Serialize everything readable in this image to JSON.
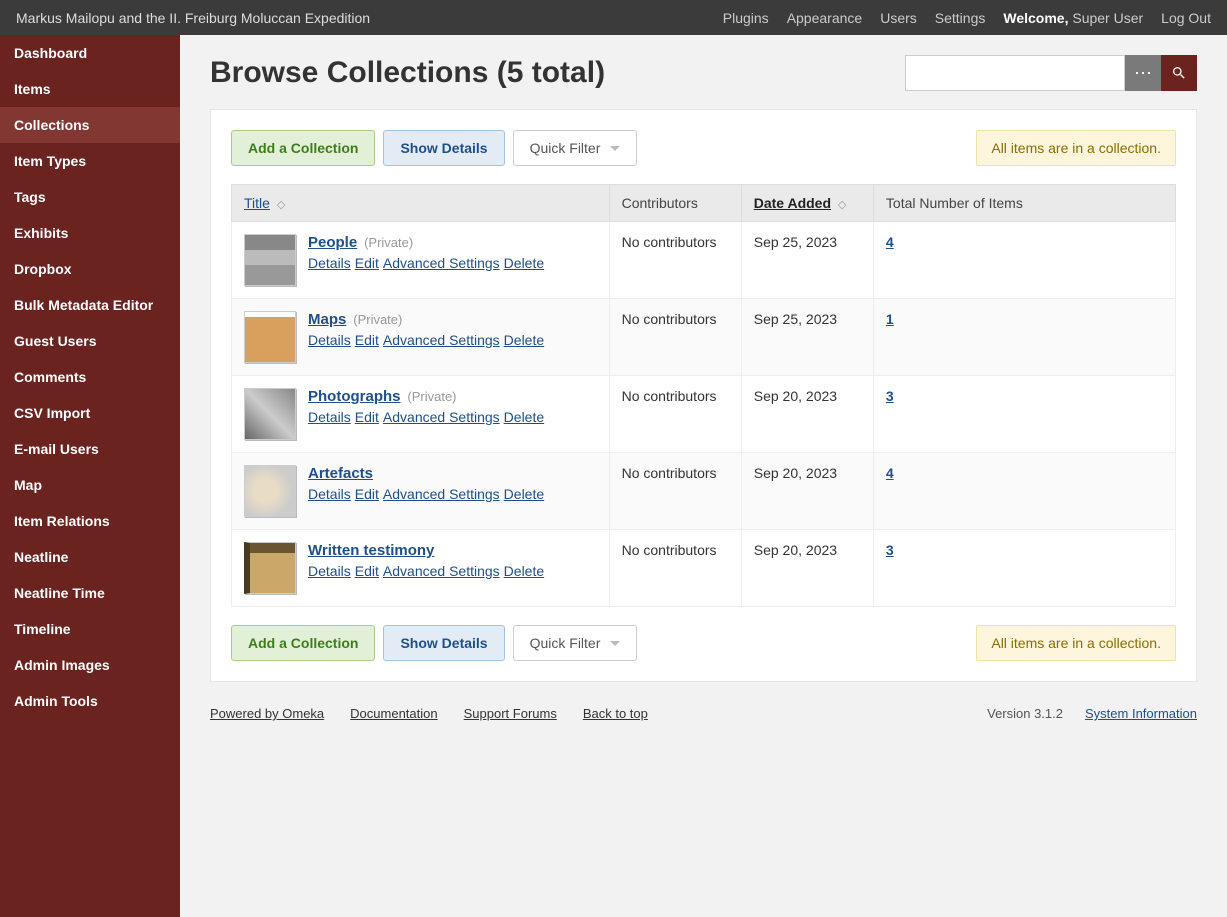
{
  "topbar": {
    "site_title": "Markus Mailopu and the II. Freiburg Moluccan Expedition",
    "links": {
      "plugins": "Plugins",
      "appearance": "Appearance",
      "users": "Users",
      "settings": "Settings"
    },
    "welcome_label": "Welcome,",
    "username": "Super User",
    "logout": "Log Out"
  },
  "sidebar": {
    "items": [
      {
        "label": "Dashboard"
      },
      {
        "label": "Items"
      },
      {
        "label": "Collections"
      },
      {
        "label": "Item Types"
      },
      {
        "label": "Tags"
      },
      {
        "label": "Exhibits"
      },
      {
        "label": "Dropbox"
      },
      {
        "label": "Bulk Metadata Editor"
      },
      {
        "label": "Guest Users"
      },
      {
        "label": "Comments"
      },
      {
        "label": "CSV Import"
      },
      {
        "label": "E-mail Users"
      },
      {
        "label": "Map"
      },
      {
        "label": "Item Relations"
      },
      {
        "label": "Neatline"
      },
      {
        "label": "Neatline Time"
      },
      {
        "label": "Timeline"
      },
      {
        "label": "Admin Images"
      },
      {
        "label": "Admin Tools"
      }
    ],
    "active_index": 2
  },
  "page": {
    "title": "Browse Collections (5 total)"
  },
  "search": {
    "value": "",
    "placeholder": ""
  },
  "toolbar": {
    "add_label": "Add a Collection",
    "show_details_label": "Show Details",
    "quick_filter_label": "Quick Filter",
    "notice": "All items are in a collection."
  },
  "table": {
    "columns": {
      "title": "Title",
      "contributors": "Contributors",
      "date_added": "Date Added",
      "total_items": "Total Number of Items"
    },
    "actions": {
      "details": "Details",
      "edit": "Edit",
      "advanced": "Advanced Settings",
      "delete": "Delete"
    },
    "private_label": "(Private)",
    "rows": [
      {
        "title": "People",
        "private": true,
        "thumb_class": "people",
        "contributors": "No contributors",
        "date": "Sep 25, 2023",
        "count": "4"
      },
      {
        "title": "Maps",
        "private": true,
        "thumb_class": "maps",
        "contributors": "No contributors",
        "date": "Sep 25, 2023",
        "count": "1"
      },
      {
        "title": "Photographs",
        "private": true,
        "thumb_class": "photos",
        "contributors": "No contributors",
        "date": "Sep 20, 2023",
        "count": "3"
      },
      {
        "title": "Artefacts",
        "private": false,
        "thumb_class": "artefacts",
        "contributors": "No contributors",
        "date": "Sep 20, 2023",
        "count": "4"
      },
      {
        "title": "Written testimony",
        "private": false,
        "thumb_class": "written",
        "contributors": "No contributors",
        "date": "Sep 20, 2023",
        "count": "3"
      }
    ]
  },
  "footer": {
    "powered": "Powered by Omeka",
    "documentation": "Documentation",
    "support": "Support Forums",
    "back_to_top": "Back to top",
    "version": "Version 3.1.2",
    "system_info": "System Information"
  }
}
